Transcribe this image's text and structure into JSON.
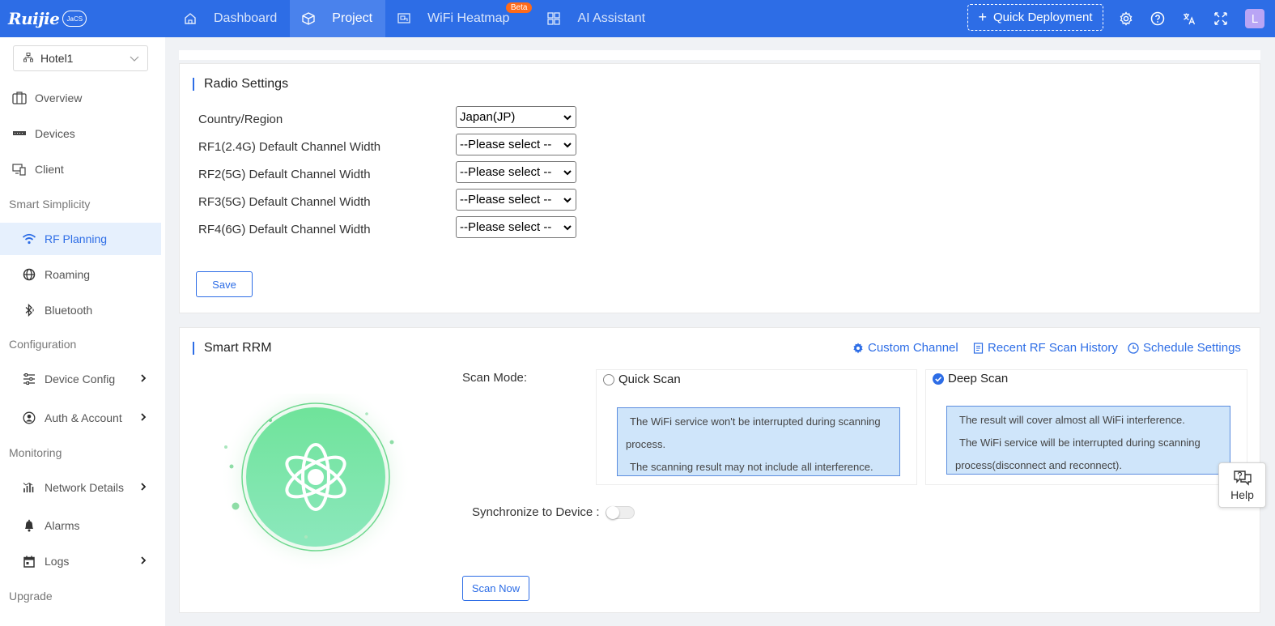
{
  "app": {
    "logo_text": "Ruijie",
    "logo_badge": "JaCS"
  },
  "nav": {
    "items": [
      {
        "label": "Dashboard",
        "icon": "home-icon"
      },
      {
        "label": "Project",
        "icon": "cube-icon"
      },
      {
        "label": "WiFi Heatmap",
        "icon": "heatmap-icon",
        "badge": "Beta"
      },
      {
        "label": "AI Assistant",
        "icon": "grid-icon"
      }
    ],
    "active": "Project",
    "quick_deployment": "Quick Deployment",
    "avatar_letter": "L"
  },
  "sidebar": {
    "site": "Hotel1",
    "items": [
      {
        "label": "Overview"
      },
      {
        "label": "Devices"
      },
      {
        "label": "Client"
      }
    ],
    "groups": {
      "smart_simplicity": "Smart Simplicity",
      "configuration": "Configuration",
      "monitoring": "Monitoring",
      "upgrade": "Upgrade"
    },
    "smart_items": [
      {
        "label": "RF Planning"
      },
      {
        "label": "Roaming"
      },
      {
        "label": "Bluetooth"
      }
    ],
    "config_items": [
      {
        "label": "Device Config"
      },
      {
        "label": "Auth & Account"
      }
    ],
    "monitor_items": [
      {
        "label": "Network Details"
      },
      {
        "label": "Alarms"
      },
      {
        "label": "Logs"
      }
    ]
  },
  "radio_settings": {
    "title": "Radio Settings",
    "fields": [
      {
        "label": "Country/Region",
        "value": "Japan(JP)"
      },
      {
        "label": "RF1(2.4G) Default Channel Width",
        "value": "--Please select --"
      },
      {
        "label": "RF2(5G) Default Channel Width",
        "value": "--Please select --"
      },
      {
        "label": "RF3(5G) Default Channel Width",
        "value": "--Please select --"
      },
      {
        "label": "RF4(6G) Default Channel Width",
        "value": "--Please select --"
      }
    ],
    "save_label": "Save"
  },
  "smart_rrm": {
    "title": "Smart RRM",
    "links": {
      "custom_channel": "Custom Channel",
      "recent_scan_history": "Recent RF Scan History",
      "schedule_settings": "Schedule Settings"
    },
    "scan_mode_label": "Scan Mode:",
    "quick_scan": {
      "label": "Quick Scan",
      "selected": false,
      "note_1": "The WiFi service won't be interrupted during scanning",
      "note_2": "process.",
      "note_3": "The scanning result may not include all interference."
    },
    "deep_scan": {
      "label": "Deep Scan",
      "selected": true,
      "note_1": "The result will cover almost all WiFi interference.",
      "note_2": "The WiFi service will be interrupted during scanning",
      "note_3": "process(disconnect and reconnect)."
    },
    "sync_label": "Synchronize to Device :",
    "sync_enabled": false,
    "scan_now": "Scan Now"
  },
  "help": {
    "label": "Help"
  },
  "colors": {
    "primary": "#2d6de6",
    "beta_badge": "#ff6a1a",
    "note_bg": "#cfe5fa",
    "scan_green": "#6fe39a"
  }
}
